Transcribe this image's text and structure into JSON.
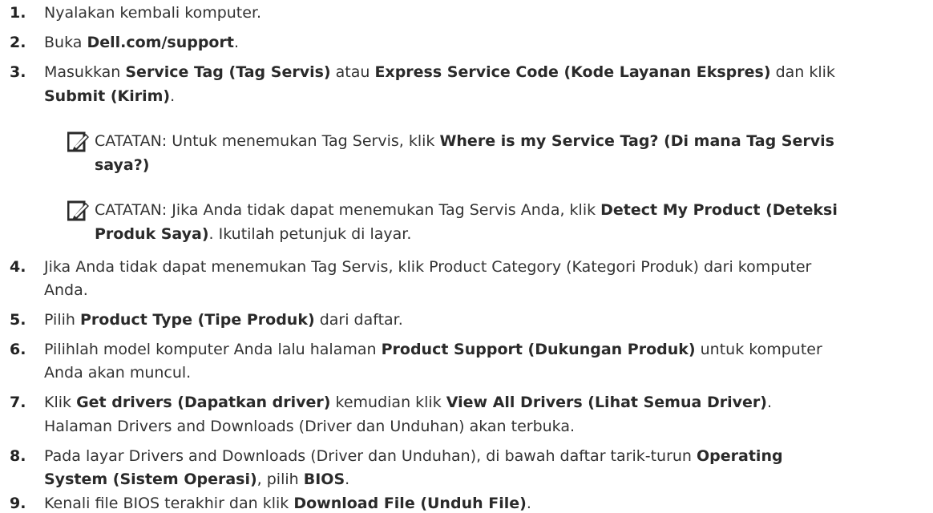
{
  "steps": [
    {
      "n": "1.",
      "t": "Nyalakan kembali komputer."
    },
    {
      "n": "2.",
      "a": "Buka ",
      "b": "Dell.com/support",
      "c": "."
    },
    {
      "n": "3.",
      "a": "Masukkan ",
      "b": "Service Tag (Tag Servis)",
      "c": " atau ",
      "d": "Express Service Code (Kode Layanan Ekspres)",
      "e": " dan klik",
      "f": "Submit (Kirim)",
      "g": "."
    },
    {
      "n": "4.",
      "a": "Jika Anda tidak dapat menemukan Tag Servis, klik Product Category (Kategori Produk) dari komputer",
      "b": "Anda."
    },
    {
      "n": "5.",
      "a": "Pilih ",
      "b": "Product Type (Tipe Produk)",
      "c": " dari daftar."
    },
    {
      "n": "6.",
      "a": "Pilihlah model komputer Anda lalu halaman ",
      "b": "Product Support (Dukungan Produk)",
      "c": " untuk komputer",
      "d": "Anda akan muncul."
    },
    {
      "n": "7.",
      "a": "Klik ",
      "b": "Get drivers (Dapatkan driver)",
      "c": " kemudian klik ",
      "d": "View All Drivers (Lihat Semua Driver)",
      "e": ".",
      "f": "Halaman Drivers and Downloads (Driver dan Unduhan) akan terbuka."
    },
    {
      "n": "8.",
      "a": "Pada layar Drivers and Downloads (Driver dan Unduhan), di bawah daftar tarik-turun ",
      "b": "Operating",
      "c": "System (Sistem Operasi)",
      "d": ", pilih ",
      "e": "BIOS",
      "f": "."
    },
    {
      "n": "9.",
      "a": "Kenali file BIOS terakhir dan klik ",
      "b": "Download File (Unduh File)",
      "c": "."
    }
  ],
  "notes": [
    {
      "label": "CATATAN:",
      "a": " Untuk menemukan Tag Servis, klik ",
      "b": "Where is my Service Tag? (Di mana Tag Servis",
      "c": "saya?)",
      "icon": "pencil-note-icon"
    },
    {
      "label": "CATATAN:",
      "a": " Jika Anda tidak dapat menemukan Tag Servis Anda, klik ",
      "b": "Detect My Product (Deteksi",
      "c": "Produk Saya)",
      "d": ". Ikutilah petunjuk di layar.",
      "icon": "pencil-note-icon"
    }
  ]
}
